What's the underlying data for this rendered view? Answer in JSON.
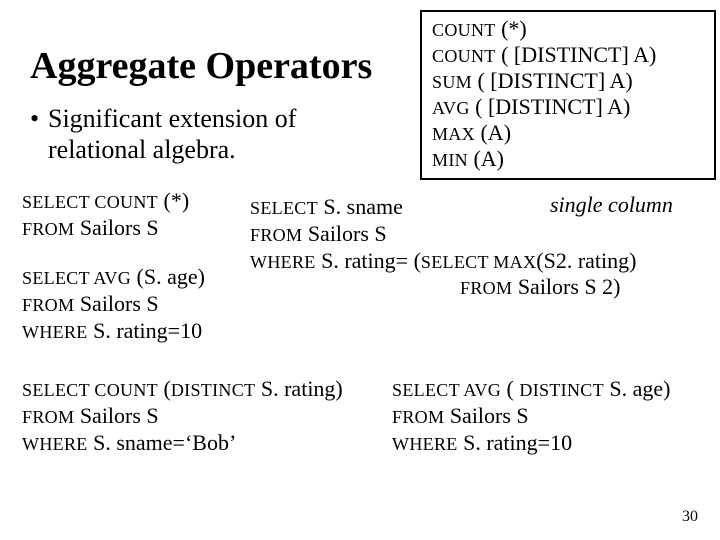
{
  "title": "Aggregate Operators",
  "bullet": {
    "marker": "•",
    "l1": "Significant extension of",
    "l2": "relational algebra."
  },
  "opbox": {
    "l1a": "COUNT",
    "l1b": " (*)",
    "l2a": "COUNT",
    "l2b": " ( [DISTINCT] A)",
    "l3a": "SUM",
    "l3b": " ( [DISTINCT] A)",
    "l4a": "AVG",
    "l4b": " ( [DISTINCT] A)",
    "l5a": "MAX",
    "l5b": " (A)",
    "l6a": "MIN",
    "l6b": " (A)"
  },
  "q1": {
    "l1a": "SELECT  COUNT",
    "l1b": " (*)",
    "l2a": "FROM",
    "l2b": "   Sailors S"
  },
  "q2": {
    "l1a": "SELECT  AVG",
    "l1b": " (S. age)",
    "l2a": "FROM",
    "l2b": "  Sailors S",
    "l3a": "WHERE",
    "l3b": "  S. rating=10"
  },
  "q3": {
    "l1a": "SELECT",
    "l1b": "  S. sname",
    "l2a": "FROM",
    "l2b": "   Sailors S",
    "l3a": "WHERE",
    "l3b": "  S. rating= (",
    "l3c": "SELECT  MAX",
    "l3d": "(S2. rating)",
    "l4a": "FROM",
    "l4b": "  Sailors S 2)"
  },
  "single_column": "single column",
  "q4": {
    "l1a": "SELECT  COUNT",
    "l1b": " (",
    "l1c": "DISTINCT",
    "l1d": " S. rating)",
    "l2a": "FROM",
    "l2b": "   Sailors S",
    "l3a": "WHERE",
    "l3b": " S. sname=‘Bob’"
  },
  "q5": {
    "l1a": "SELECT  AVG",
    "l1b": " ( ",
    "l1c": "DISTINCT",
    "l1d": " S. age)",
    "l2a": "FROM",
    "l2b": "  Sailors S",
    "l3a": "WHERE",
    "l3b": "  S. rating=10"
  },
  "pagenum": "30"
}
